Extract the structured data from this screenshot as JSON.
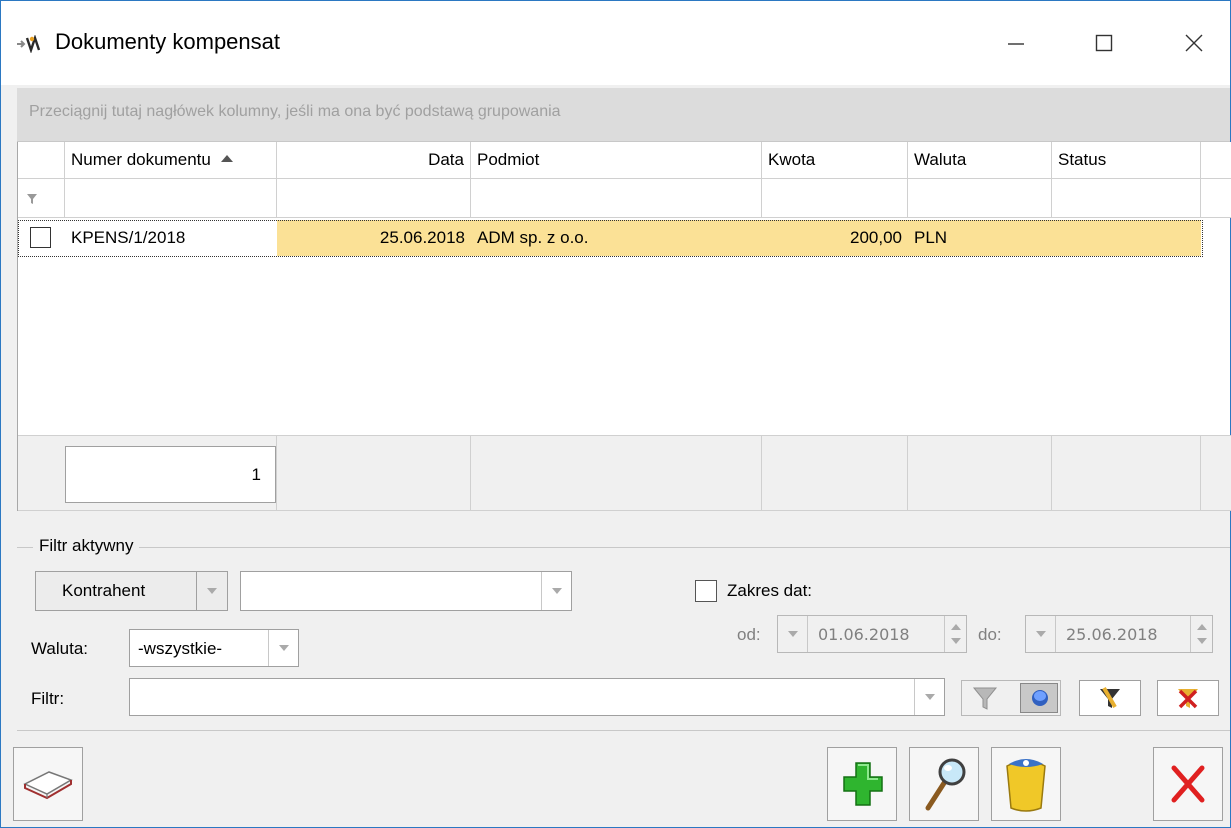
{
  "window": {
    "title": "Dokumenty kompensat",
    "min_glyph": "—",
    "max_glyph": "☐",
    "close_glyph": "✕"
  },
  "grid": {
    "group_hint": "Przeciągnij tutaj nagłówek kolumny, jeśli ma ona być podstawą grupowania",
    "columns": [
      "Numer dokumentu",
      "Data",
      "Podmiot",
      "Kwota",
      "Waluta",
      "Status"
    ],
    "sorted_column": "Numer dokumentu",
    "rows": [
      {
        "numer": "KPENS/1/2018",
        "data": "25.06.2018",
        "podmiot": "ADM sp. z o.o.",
        "kwota": "200,00",
        "waluta": "PLN",
        "status": ""
      }
    ],
    "footer_count": "1"
  },
  "filter": {
    "legend": "Filtr aktywny",
    "kontrahent_label": "Kontrahent",
    "kontrahent_value": "",
    "zakres_dat_label": "Zakres dat:",
    "od_label": "od:",
    "od_value": "01.06.2018",
    "do_label": "do:",
    "do_value": "25.06.2018",
    "waluta_label": "Waluta:",
    "waluta_value": "-wszystkie-",
    "filtr_label": "Filtr:",
    "filtr_value": ""
  },
  "colors": {
    "selected_row": "#fbe196",
    "accent_border": "#2b78c2",
    "add_green": "#2fb52f",
    "close_red": "#e02020"
  }
}
